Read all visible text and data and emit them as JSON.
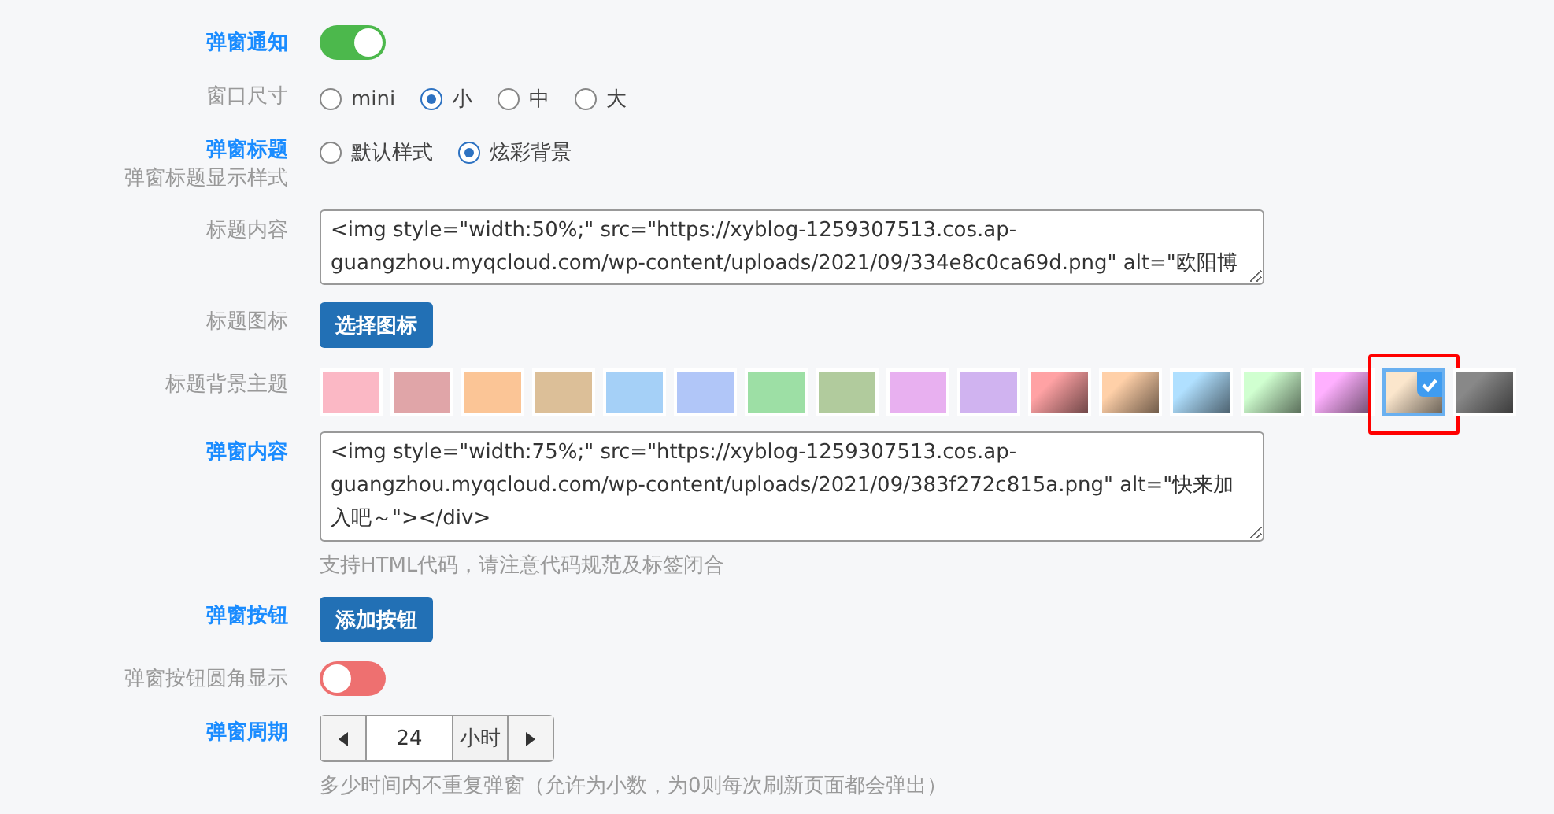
{
  "rows": [
    {
      "kind": "toggle",
      "label": "弹窗通知",
      "emphasized": true,
      "on": true
    },
    {
      "kind": "radio",
      "label": "窗口尺寸",
      "emphasized": false,
      "options": [
        {
          "label": "mini",
          "selected": false
        },
        {
          "label": "小",
          "selected": true
        },
        {
          "label": "中",
          "selected": false
        },
        {
          "label": "大",
          "selected": false
        }
      ]
    },
    {
      "kind": "radio",
      "label": "弹窗标题",
      "sublabel": "弹窗标题显示样式",
      "emphasized": true,
      "options": [
        {
          "label": "默认样式",
          "selected": false
        },
        {
          "label": "炫彩背景",
          "selected": true
        }
      ]
    },
    {
      "kind": "textarea",
      "label": "标题内容",
      "emphasized": false,
      "value": "<img style=\"width:50%;\" src=\"https://xyblog-1259307513.cos.ap-guangzhou.myqcloud.com/wp-content/uploads/2021/09/334e8c0ca69d.png\" alt=\"欧阳博"
    },
    {
      "kind": "button",
      "label": "标题图标",
      "emphasized": false,
      "button": "选择图标"
    },
    {
      "kind": "swatches",
      "label": "标题背景主题",
      "emphasized": false,
      "swatches": [
        {
          "color": "#fbb8c5",
          "selected": false
        },
        {
          "color": "#e0a5a8",
          "selected": false
        },
        {
          "color": "#fbc596",
          "selected": false
        },
        {
          "color": "#dcbf98",
          "selected": false
        },
        {
          "color": "#a5d0f7",
          "selected": false
        },
        {
          "color": "#b1c6f8",
          "selected": false
        },
        {
          "color": "#9ddfa5",
          "selected": false
        },
        {
          "color": "#b1cb9d",
          "selected": false
        },
        {
          "color": "#e8b0f0",
          "selected": false
        },
        {
          "color": "#d0b3f0",
          "selected": false
        },
        {
          "color": "#ffa2a4",
          "kind": "gradient",
          "selected": false
        },
        {
          "color": "#ffd0a8",
          "kind": "gradient",
          "selected": false
        },
        {
          "color": "#b0e0ff",
          "kind": "gradient",
          "selected": false
        },
        {
          "color": "#d0ffd0",
          "kind": "gradient",
          "selected": false
        },
        {
          "color": "#ffb0ff",
          "kind": "gradient",
          "selected": false
        },
        {
          "color": "#fbe6cc",
          "kind": "gradient",
          "selected": true
        },
        {
          "color": "#888888",
          "kind": "gradient",
          "selected": false
        }
      ]
    },
    {
      "kind": "textarea",
      "label": "弹窗内容",
      "emphasized": true,
      "value": "<img style=\"width:75%;\" src=\"https://xyblog-1259307513.cos.ap-guangzhou.myqcloud.com/wp-content/uploads/2021/09/383f272c815a.png\" alt=\"快来加入吧～\"></div>",
      "hint": "支持HTML代码，请注意代码规范及标签闭合"
    },
    {
      "kind": "button",
      "label": "弹窗按钮",
      "emphasized": true,
      "button": "添加按钮"
    },
    {
      "kind": "toggle",
      "label": "弹窗按钮圆角显示",
      "emphasized": false,
      "on": false
    },
    {
      "kind": "stepper",
      "label": "弹窗周期",
      "emphasized": true,
      "value": "24",
      "unit": "小时",
      "hint": "多少时间内不重复弹窗（允许为小数，为0则每次刷新页面都会弹出）"
    }
  ]
}
